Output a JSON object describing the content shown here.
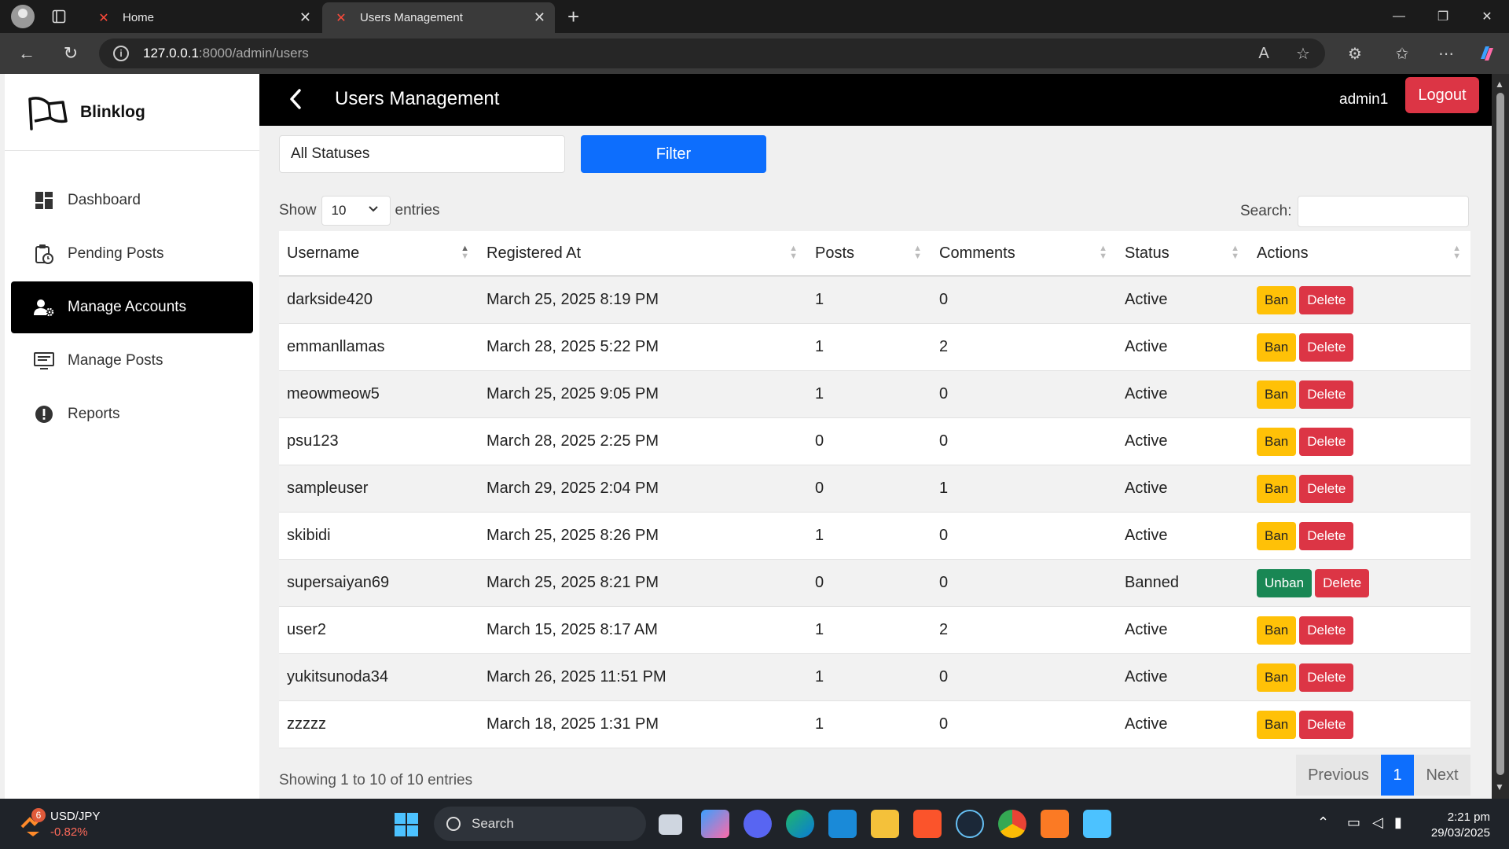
{
  "browser": {
    "tabs": [
      {
        "label": "Home"
      },
      {
        "label": "Users Management"
      }
    ],
    "url_host": "127.0.0.1",
    "url_path": ":8000/admin/users"
  },
  "sidebar": {
    "brand": "Blinklog",
    "items": [
      {
        "label": "Dashboard",
        "icon": "dashboard-icon"
      },
      {
        "label": "Pending Posts",
        "icon": "clipboard-clock-icon"
      },
      {
        "label": "Manage Accounts",
        "icon": "user-gear-icon",
        "active": true
      },
      {
        "label": "Manage Posts",
        "icon": "monitor-list-icon"
      },
      {
        "label": "Reports",
        "icon": "alert-circle-icon"
      }
    ]
  },
  "header": {
    "title": "Users Management",
    "user": "admin1",
    "logout_label": "Logout"
  },
  "filters": {
    "status_value": "All Statuses",
    "filter_label": "Filter"
  },
  "table_controls": {
    "show_label": "Show",
    "length_value": "10",
    "entries_label": "entries",
    "search_label": "Search:"
  },
  "table": {
    "columns": [
      "Username",
      "Registered At",
      "Posts",
      "Comments",
      "Status",
      "Actions"
    ],
    "rows": [
      {
        "username": "darkside420",
        "registered": "March 25, 2025 8:19 PM",
        "posts": "1",
        "comments": "0",
        "status": "Active",
        "action": "Ban",
        "delete": "Delete"
      },
      {
        "username": "emmanllamas",
        "registered": "March 28, 2025 5:22 PM",
        "posts": "1",
        "comments": "2",
        "status": "Active",
        "action": "Ban",
        "delete": "Delete"
      },
      {
        "username": "meowmeow5",
        "registered": "March 25, 2025 9:05 PM",
        "posts": "1",
        "comments": "0",
        "status": "Active",
        "action": "Ban",
        "delete": "Delete"
      },
      {
        "username": "psu123",
        "registered": "March 28, 2025 2:25 PM",
        "posts": "0",
        "comments": "0",
        "status": "Active",
        "action": "Ban",
        "delete": "Delete"
      },
      {
        "username": "sampleuser",
        "registered": "March 29, 2025 2:04 PM",
        "posts": "0",
        "comments": "1",
        "status": "Active",
        "action": "Ban",
        "delete": "Delete"
      },
      {
        "username": "skibidi",
        "registered": "March 25, 2025 8:26 PM",
        "posts": "1",
        "comments": "0",
        "status": "Active",
        "action": "Ban",
        "delete": "Delete"
      },
      {
        "username": "supersaiyan69",
        "registered": "March 25, 2025 8:21 PM",
        "posts": "0",
        "comments": "0",
        "status": "Banned",
        "action": "Unban",
        "delete": "Delete"
      },
      {
        "username": "user2",
        "registered": "March 15, 2025 8:17 AM",
        "posts": "1",
        "comments": "2",
        "status": "Active",
        "action": "Ban",
        "delete": "Delete"
      },
      {
        "username": "yukitsunoda34",
        "registered": "March 26, 2025 11:51 PM",
        "posts": "1",
        "comments": "0",
        "status": "Active",
        "action": "Ban",
        "delete": "Delete"
      },
      {
        "username": "zzzzz",
        "registered": "March 18, 2025 1:31 PM",
        "posts": "1",
        "comments": "0",
        "status": "Active",
        "action": "Ban",
        "delete": "Delete"
      }
    ],
    "info": "Showing 1 to 10 of 10 entries",
    "pagination": {
      "prev": "Previous",
      "current": "1",
      "next": "Next"
    }
  },
  "taskbar": {
    "ticker_name": "USD/JPY",
    "ticker_change": "-0.82%",
    "badge_count": "6",
    "search_label": "Search",
    "time": "2:21 pm",
    "date": "29/03/2025"
  },
  "colors": {
    "primary": "#0d6efd",
    "danger": "#dc3545",
    "warning": "#ffc107",
    "success": "#198754",
    "header_bg": "#000000"
  }
}
